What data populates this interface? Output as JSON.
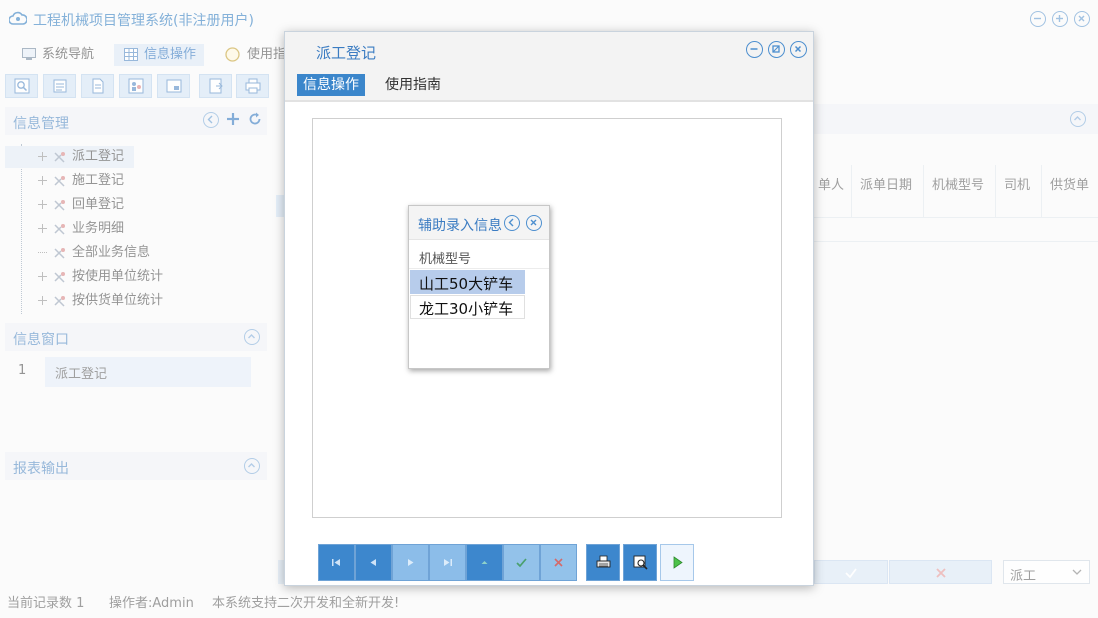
{
  "app": {
    "title": "工程机械项目管理系统(非注册用户)"
  },
  "menu": [
    {
      "label": "系统导航",
      "icon": "monitor-icon",
      "selected": false
    },
    {
      "label": "信息操作",
      "icon": "grid-icon",
      "selected": true
    },
    {
      "label": "使用指",
      "icon": "guide-icon",
      "selected": false
    }
  ],
  "toolbar": {
    "icons": [
      "zoom-icon",
      "list-icon",
      "document-icon",
      "users-icon",
      "preview-icon",
      "export-icon",
      "print-icon"
    ]
  },
  "sidebar": {
    "info_management": {
      "title": "信息管理",
      "items": [
        {
          "label": "派工登记",
          "selected": true,
          "expandable": true
        },
        {
          "label": "施工登记",
          "selected": false,
          "expandable": true
        },
        {
          "label": "回单登记",
          "selected": false,
          "expandable": true
        },
        {
          "label": "业务明细",
          "selected": false,
          "expandable": true
        },
        {
          "label": "全部业务信息",
          "selected": false,
          "expandable": false
        },
        {
          "label": "按使用单位统计",
          "selected": false,
          "expandable": true
        },
        {
          "label": "按供货单位统计",
          "selected": false,
          "expandable": true
        }
      ]
    },
    "info_window": {
      "title": "信息窗口",
      "rows": [
        {
          "num": "1",
          "label": "派工登记"
        }
      ]
    },
    "report": {
      "title": "报表输出"
    }
  },
  "grid": {
    "headers": [
      "单人",
      "派单日期",
      "机械型号",
      "司机",
      "供货单"
    ]
  },
  "bottom_controls": {
    "dispatch_select": "派工"
  },
  "status": {
    "record_count": "当前记录数 1",
    "operator": "操作者:Admin",
    "notice": "本系统支持二次开发和全新开发!"
  },
  "dialog": {
    "title": "派工登记",
    "tabs": [
      {
        "label": "信息操作",
        "active": true
      },
      {
        "label": "使用指南",
        "active": false
      }
    ],
    "toolbar": {
      "buttons": [
        {
          "name": "first-record-button",
          "icon": "first-icon",
          "style": "dark"
        },
        {
          "name": "prev-record-button",
          "icon": "prev-icon",
          "style": "dark"
        },
        {
          "name": "next-record-button",
          "icon": "next-icon",
          "style": "light"
        },
        {
          "name": "last-record-button",
          "icon": "last-icon",
          "style": "light"
        },
        {
          "name": "add-record-button",
          "icon": "up-icon",
          "style": "dark"
        },
        {
          "name": "confirm-button",
          "icon": "check-icon",
          "style": "cfm"
        },
        {
          "name": "cancel-button",
          "icon": "cross-icon",
          "style": "cfm"
        },
        {
          "name": "print-button",
          "icon": "printer-icon",
          "style": "dark"
        },
        {
          "name": "preview-button",
          "icon": "print-preview-icon",
          "style": "dark"
        },
        {
          "name": "run-button",
          "icon": "play-icon",
          "style": "outline"
        }
      ]
    }
  },
  "helper": {
    "title": "辅助录入信息",
    "column": "机械型号",
    "rows": [
      {
        "label": "山工50大铲车",
        "selected": true
      },
      {
        "label": "龙工30小铲车",
        "selected": false
      }
    ]
  }
}
